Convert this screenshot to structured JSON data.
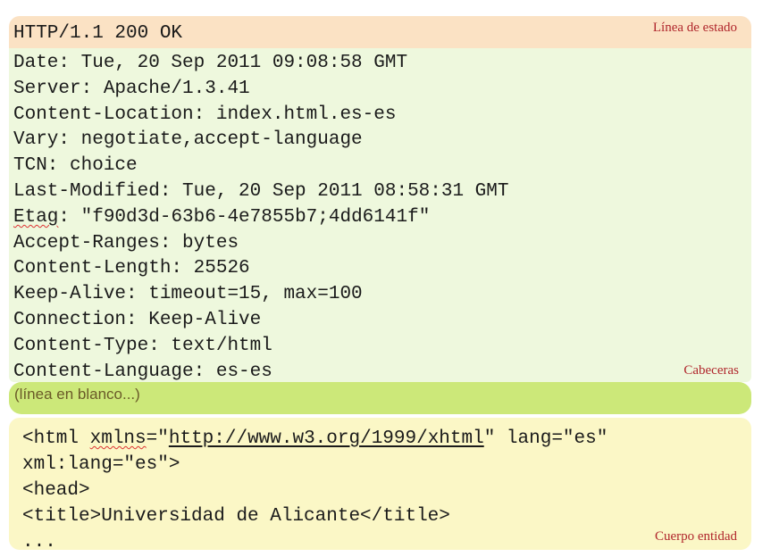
{
  "status": {
    "line": "HTTP/1.1 200 OK",
    "tag": "Línea de estado"
  },
  "headers": {
    "lines": [
      "Date: Tue, 20 Sep 2011 09:08:58 GMT",
      "Server: Apache/1.3.41",
      "Content-Location: index.html.es-es",
      "Vary: negotiate,accept-language",
      "TCN: choice",
      "Last-Modified: Tue, 20 Sep 2011 08:58:31 GMT"
    ],
    "etag_name": "Etag",
    "etag_value": ": \"f90d3d-63b6-4e7855b7;4dd6141f\"",
    "lines2": [
      "Accept-Ranges: bytes",
      "Content-Length: 25526",
      "Keep-Alive: timeout=15, max=100",
      "Connection: Keep-Alive",
      "Content-Type: text/html",
      "Content-Language: es-es"
    ],
    "tag": "Cabeceras"
  },
  "blank": {
    "text": "(línea en blanco...)"
  },
  "body": {
    "line1_start": "<html ",
    "line1_attr": "xmlns",
    "line1_eq": "=\"",
    "line1_url": "http://www.w3.org/1999/xhtml",
    "line1_end": "\" lang=\"es\"",
    "lines": [
      "xml:lang=\"es\">",
      "<head>",
      "<title>Universidad de Alicante</title>",
      "..."
    ],
    "tag": "Cuerpo entidad"
  }
}
